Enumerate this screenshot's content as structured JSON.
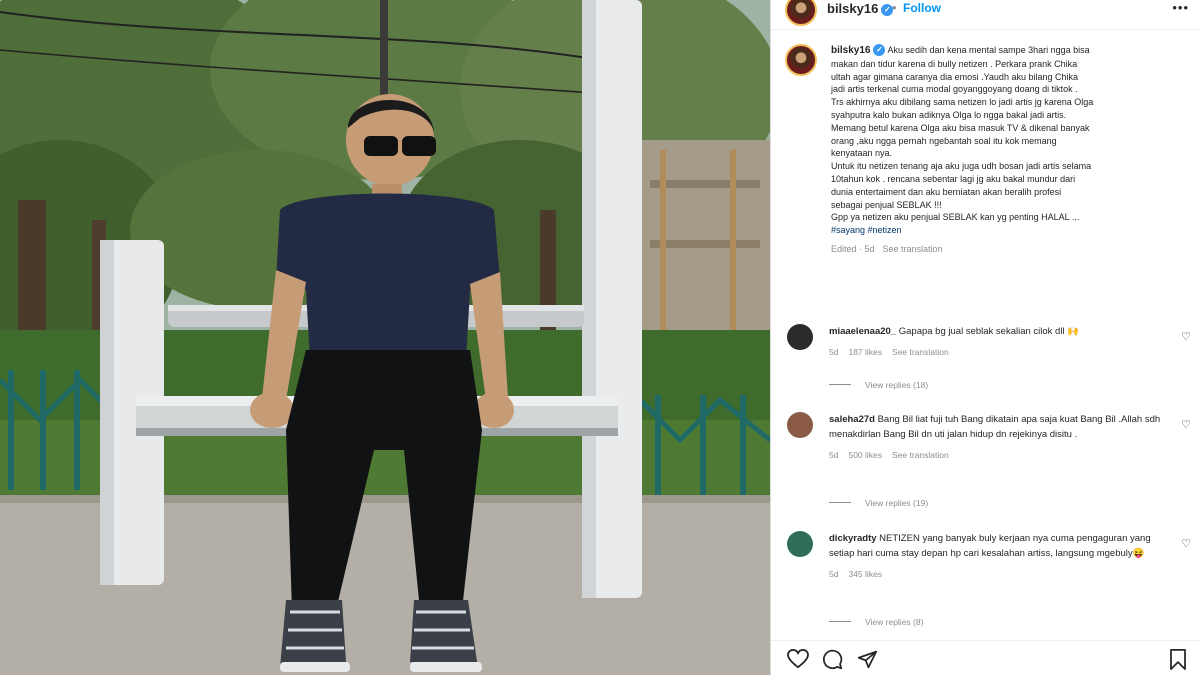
{
  "post": {
    "username": "bilsky16",
    "verified_glyph": "✓",
    "dot": "•",
    "follow_label": "Follow",
    "more_icon": "•••",
    "caption_lines": [
      "Aku sedih dan kena mental sampe 3hari ngga bisa",
      "makan dan tidur karena di bully netizen . Perkara prank Chika",
      "ultah agar gimana caranya dia emosi .Yaudh aku bilang Chika",
      "jadi artis terkenal cuma modal goyanggoyang doang di tiktok .",
      "Trs akhirnya aku dibilang sama netizen lo jadi artis jg karena Olga",
      "syahputra kalo bukan adiknya Olga lo ngga bakal jadi artis.",
      "Memang betul karena Olga aku bisa masuk TV & dikenal banyak",
      "orang ,aku ngga pernah ngebantah soal itu kok memang",
      "kenyataan nya.",
      "Untuk itu netizen tenang aja aku juga udh bosan jadi artis selama",
      "10tahun kok . rencana sebentar lagi jg aku bakal mundur dari",
      "dunia entertaiment dan aku berniatan akan beralih profesi",
      "sebagai penjual SEBLAK !!!",
      "Gpp ya netizen aku penjual SEBLAK kan yg penting HALAL ..."
    ],
    "hashtags": "#sayang #netizen",
    "caption_meta": {
      "edited": "Edited · 5d",
      "translate": "See translation"
    }
  },
  "comments": [
    {
      "username": "miaaelenaa20_",
      "text": "Gapapa bg jual seblak sekalian cilok dll 🙌",
      "time": "5d",
      "likes": "187 likes",
      "translate": "See translation",
      "replies": "View replies (18)",
      "avatar_color": "#2b2b2b"
    },
    {
      "username": "saleha27d",
      "text": "Bang Bil liat fuji tuh Bang dikatain apa saja kuat Bang Bil .Allah sdh menakdirlan Bang Bil dn uti jalan hidup dn rejekinya disitu .",
      "time": "5d",
      "likes": "500 likes",
      "translate": "See translation",
      "replies": "View replies (19)",
      "avatar_color": "#8a5a45"
    },
    {
      "username": "dickyradty",
      "text": "NETIZEN yang banyak buly kerjaan nya cuma pengaguran yang setiap hari cuma stay depan hp cari kesalahan artiss, langsung mgebuly😝",
      "time": "5d",
      "likes": "345 likes",
      "translate": "",
      "replies": "View replies (8)",
      "avatar_color": "#2f6d5a"
    }
  ],
  "icons": {
    "heart": "heart-icon",
    "comment": "comment-icon",
    "share": "share-icon",
    "save": "bookmark-icon"
  }
}
